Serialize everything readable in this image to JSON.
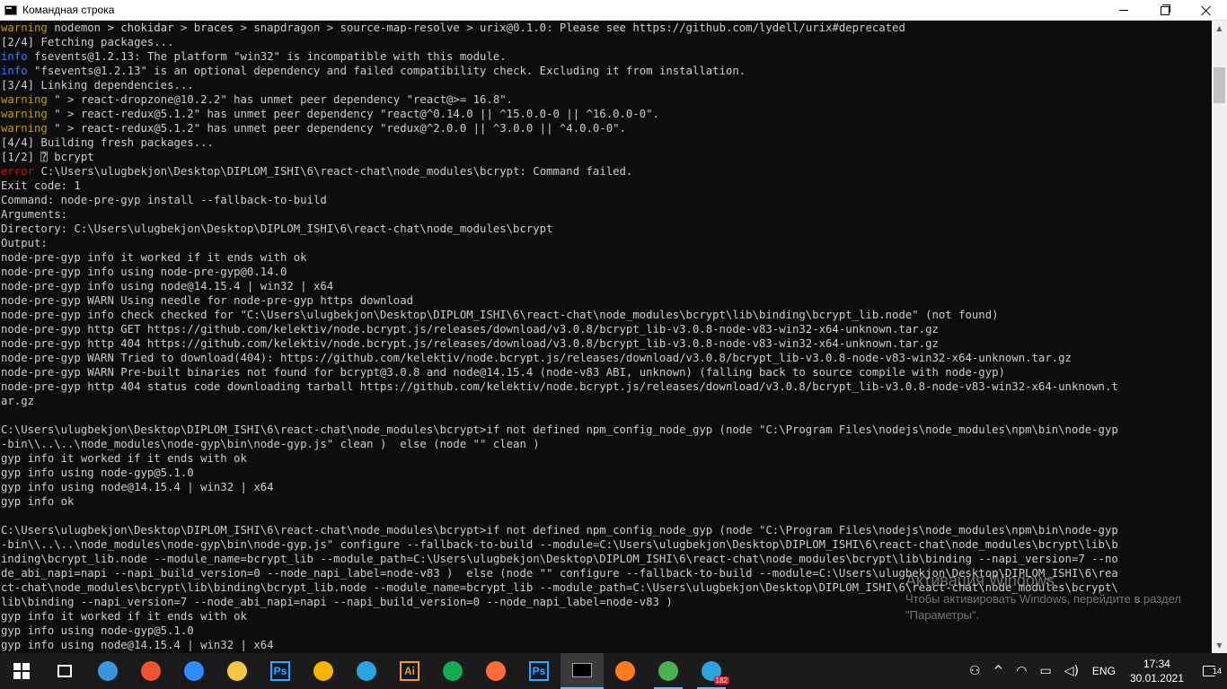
{
  "window": {
    "title": "Командная строка",
    "controls": {
      "minimize_icon": "minimize-icon",
      "maximize_icon": "restore-icon",
      "close_icon": "close-icon"
    }
  },
  "colors": {
    "warning": "#c19c00",
    "info": "#3b78ff",
    "error": "#c50f1f",
    "text": "#cccccc",
    "background": "#0c0c0c"
  },
  "console": {
    "lines": [
      {
        "level": "warning",
        "text": "nodemon > chokidar > braces > snapdragon > source-map-resolve > urix@0.1.0: Please see https://github.com/lydell/urix#deprecated"
      },
      {
        "level": "",
        "text": "[2/4] Fetching packages..."
      },
      {
        "level": "info",
        "text": "fsevents@1.2.13: The platform \"win32\" is incompatible with this module."
      },
      {
        "level": "info",
        "text": "\"fsevents@1.2.13\" is an optional dependency and failed compatibility check. Excluding it from installation."
      },
      {
        "level": "",
        "text": "[3/4] Linking dependencies..."
      },
      {
        "level": "warning",
        "text": "\" > react-dropzone@10.2.2\" has unmet peer dependency \"react@>= 16.8\"."
      },
      {
        "level": "warning",
        "text": "\" > react-redux@5.1.2\" has unmet peer dependency \"react@^0.14.0 || ^15.0.0-0 || ^16.0.0-0\"."
      },
      {
        "level": "warning",
        "text": "\" > react-redux@5.1.2\" has unmet peer dependency \"redux@^2.0.0 || ^3.0.0 || ^4.0.0-0\"."
      },
      {
        "level": "",
        "text": "[4/4] Building fresh packages..."
      },
      {
        "level": "",
        "text": "[1/2] ⍰ bcrypt"
      },
      {
        "level": "error",
        "text": "C:\\Users\\ulugbekjon\\Desktop\\DIPLOM_ISHI\\6\\react-chat\\node_modules\\bcrypt: Command failed."
      },
      {
        "level": "",
        "text": "Exit code: 1"
      },
      {
        "level": "",
        "text": "Command: node-pre-gyp install --fallback-to-build"
      },
      {
        "level": "",
        "text": "Arguments:"
      },
      {
        "level": "",
        "text": "Directory: C:\\Users\\ulugbekjon\\Desktop\\DIPLOM_ISHI\\6\\react-chat\\node_modules\\bcrypt"
      },
      {
        "level": "",
        "text": "Output:"
      },
      {
        "level": "",
        "text": "node-pre-gyp info it worked if it ends with ok"
      },
      {
        "level": "",
        "text": "node-pre-gyp info using node-pre-gyp@0.14.0"
      },
      {
        "level": "",
        "text": "node-pre-gyp info using node@14.15.4 | win32 | x64"
      },
      {
        "level": "",
        "text": "node-pre-gyp WARN Using needle for node-pre-gyp https download"
      },
      {
        "level": "",
        "text": "node-pre-gyp info check checked for \"C:\\Users\\ulugbekjon\\Desktop\\DIPLOM_ISHI\\6\\react-chat\\node_modules\\bcrypt\\lib\\binding\\bcrypt_lib.node\" (not found)"
      },
      {
        "level": "",
        "text": "node-pre-gyp http GET https://github.com/kelektiv/node.bcrypt.js/releases/download/v3.0.8/bcrypt_lib-v3.0.8-node-v83-win32-x64-unknown.tar.gz"
      },
      {
        "level": "",
        "text": "node-pre-gyp http 404 https://github.com/kelektiv/node.bcrypt.js/releases/download/v3.0.8/bcrypt_lib-v3.0.8-node-v83-win32-x64-unknown.tar.gz"
      },
      {
        "level": "",
        "text": "node-pre-gyp WARN Tried to download(404): https://github.com/kelektiv/node.bcrypt.js/releases/download/v3.0.8/bcrypt_lib-v3.0.8-node-v83-win32-x64-unknown.tar.gz"
      },
      {
        "level": "",
        "text": "node-pre-gyp WARN Pre-built binaries not found for bcrypt@3.0.8 and node@14.15.4 (node-v83 ABI, unknown) (falling back to source compile with node-gyp)"
      },
      {
        "level": "",
        "text": "node-pre-gyp http 404 status code downloading tarball https://github.com/kelektiv/node.bcrypt.js/releases/download/v3.0.8/bcrypt_lib-v3.0.8-node-v83-win32-x64-unknown.t"
      },
      {
        "level": "",
        "text": "ar.gz"
      },
      {
        "level": "",
        "text": ""
      },
      {
        "level": "",
        "text": "C:\\Users\\ulugbekjon\\Desktop\\DIPLOM_ISHI\\6\\react-chat\\node_modules\\bcrypt>if not defined npm_config_node_gyp (node \"C:\\Program Files\\nodejs\\node_modules\\npm\\bin\\node-gyp"
      },
      {
        "level": "",
        "text": "-bin\\\\..\\..\\node_modules\\node-gyp\\bin\\node-gyp.js\" clean )  else (node \"\" clean )"
      },
      {
        "level": "",
        "text": "gyp info it worked if it ends with ok"
      },
      {
        "level": "",
        "text": "gyp info using node-gyp@5.1.0"
      },
      {
        "level": "",
        "text": "gyp info using node@14.15.4 | win32 | x64"
      },
      {
        "level": "",
        "text": "gyp info ok"
      },
      {
        "level": "",
        "text": ""
      },
      {
        "level": "",
        "text": "C:\\Users\\ulugbekjon\\Desktop\\DIPLOM_ISHI\\6\\react-chat\\node_modules\\bcrypt>if not defined npm_config_node_gyp (node \"C:\\Program Files\\nodejs\\node_modules\\npm\\bin\\node-gyp"
      },
      {
        "level": "",
        "text": "-bin\\\\..\\..\\node_modules\\node-gyp\\bin\\node-gyp.js\" configure --fallback-to-build --module=C:\\Users\\ulugbekjon\\Desktop\\DIPLOM_ISHI\\6\\react-chat\\node_modules\\bcrypt\\lib\\b"
      },
      {
        "level": "",
        "text": "inding\\bcrypt_lib.node --module_name=bcrypt_lib --module_path=C:\\Users\\ulugbekjon\\Desktop\\DIPLOM_ISHI\\6\\react-chat\\node_modules\\bcrypt\\lib\\binding --napi_version=7 --no"
      },
      {
        "level": "",
        "text": "de_abi_napi=napi --napi_build_version=0 --node_napi_label=node-v83 )  else (node \"\" configure --fallback-to-build --module=C:\\Users\\ulugbekjon\\Desktop\\DIPLOM_ISHI\\6\\rea"
      },
      {
        "level": "",
        "text": "ct-chat\\node_modules\\bcrypt\\lib\\binding\\bcrypt_lib.node --module_name=bcrypt_lib --module_path=C:\\Users\\ulugbekjon\\Desktop\\DIPLOM_ISHI\\6\\react-chat\\node_modules\\bcrypt\\"
      },
      {
        "level": "",
        "text": "lib\\binding --napi_version=7 --node_abi_napi=napi --napi_build_version=0 --node_napi_label=node-v83 )"
      },
      {
        "level": "",
        "text": "gyp info it worked if it ends with ok"
      },
      {
        "level": "",
        "text": "gyp info using node-gyp@5.1.0"
      },
      {
        "level": "",
        "text": "gyp info using node@14.15.4 | win32 | x64"
      }
    ]
  },
  "activation": {
    "title": "Активация Windows",
    "text": "Чтобы активировать Windows, перейдите в раздел \"Параметры\"."
  },
  "taskbar": {
    "apps": [
      {
        "icon": "start-icon",
        "label": "",
        "color": "#ffffff"
      },
      {
        "icon": "task-view-icon",
        "label": "",
        "color": "#ffffff"
      },
      {
        "icon": "computer-icon",
        "label": "",
        "color": "#3a96dd"
      },
      {
        "icon": "git-icon",
        "label": "",
        "color": "#f05033"
      },
      {
        "icon": "zoom-icon",
        "label": "",
        "color": "#2d8cff"
      },
      {
        "icon": "file-explorer-icon",
        "label": "",
        "color": "#f3c744"
      },
      {
        "icon": "photoshop-icon",
        "label": "Ps",
        "color": "#31a8ff"
      },
      {
        "icon": "star-app-icon",
        "label": "",
        "color": "#f4b400"
      },
      {
        "icon": "telegram-icon",
        "label": "",
        "color": "#2aa3de"
      },
      {
        "icon": "illustrator-icon",
        "label": "Ai",
        "color": "#ff9a00"
      },
      {
        "icon": "mongodb-compass-icon",
        "label": "",
        "color": "#13aa52"
      },
      {
        "icon": "postman-icon",
        "label": "",
        "color": "#ff6c37"
      },
      {
        "icon": "photoshop-icon",
        "label": "Ps",
        "color": "#31a8ff"
      },
      {
        "icon": "command-prompt-icon",
        "label": "",
        "color": "#cccccc"
      },
      {
        "icon": "flame-app-icon",
        "label": "",
        "color": "#ff7a1a"
      },
      {
        "icon": "chrome-icon",
        "label": "",
        "color": "#4caf50"
      },
      {
        "icon": "telegram-icon",
        "label": "",
        "color": "#2aa3de",
        "badge": "182"
      }
    ],
    "tray": {
      "people_icon": "people-icon",
      "chevron_icon": "chevron-up-icon",
      "wifi_icon": "wifi-icon",
      "battery_icon": "battery-icon",
      "volume_icon": "volume-icon",
      "language": "ENG",
      "time": "17:34",
      "date": "30.01.2021",
      "notifications_count": "14"
    }
  }
}
